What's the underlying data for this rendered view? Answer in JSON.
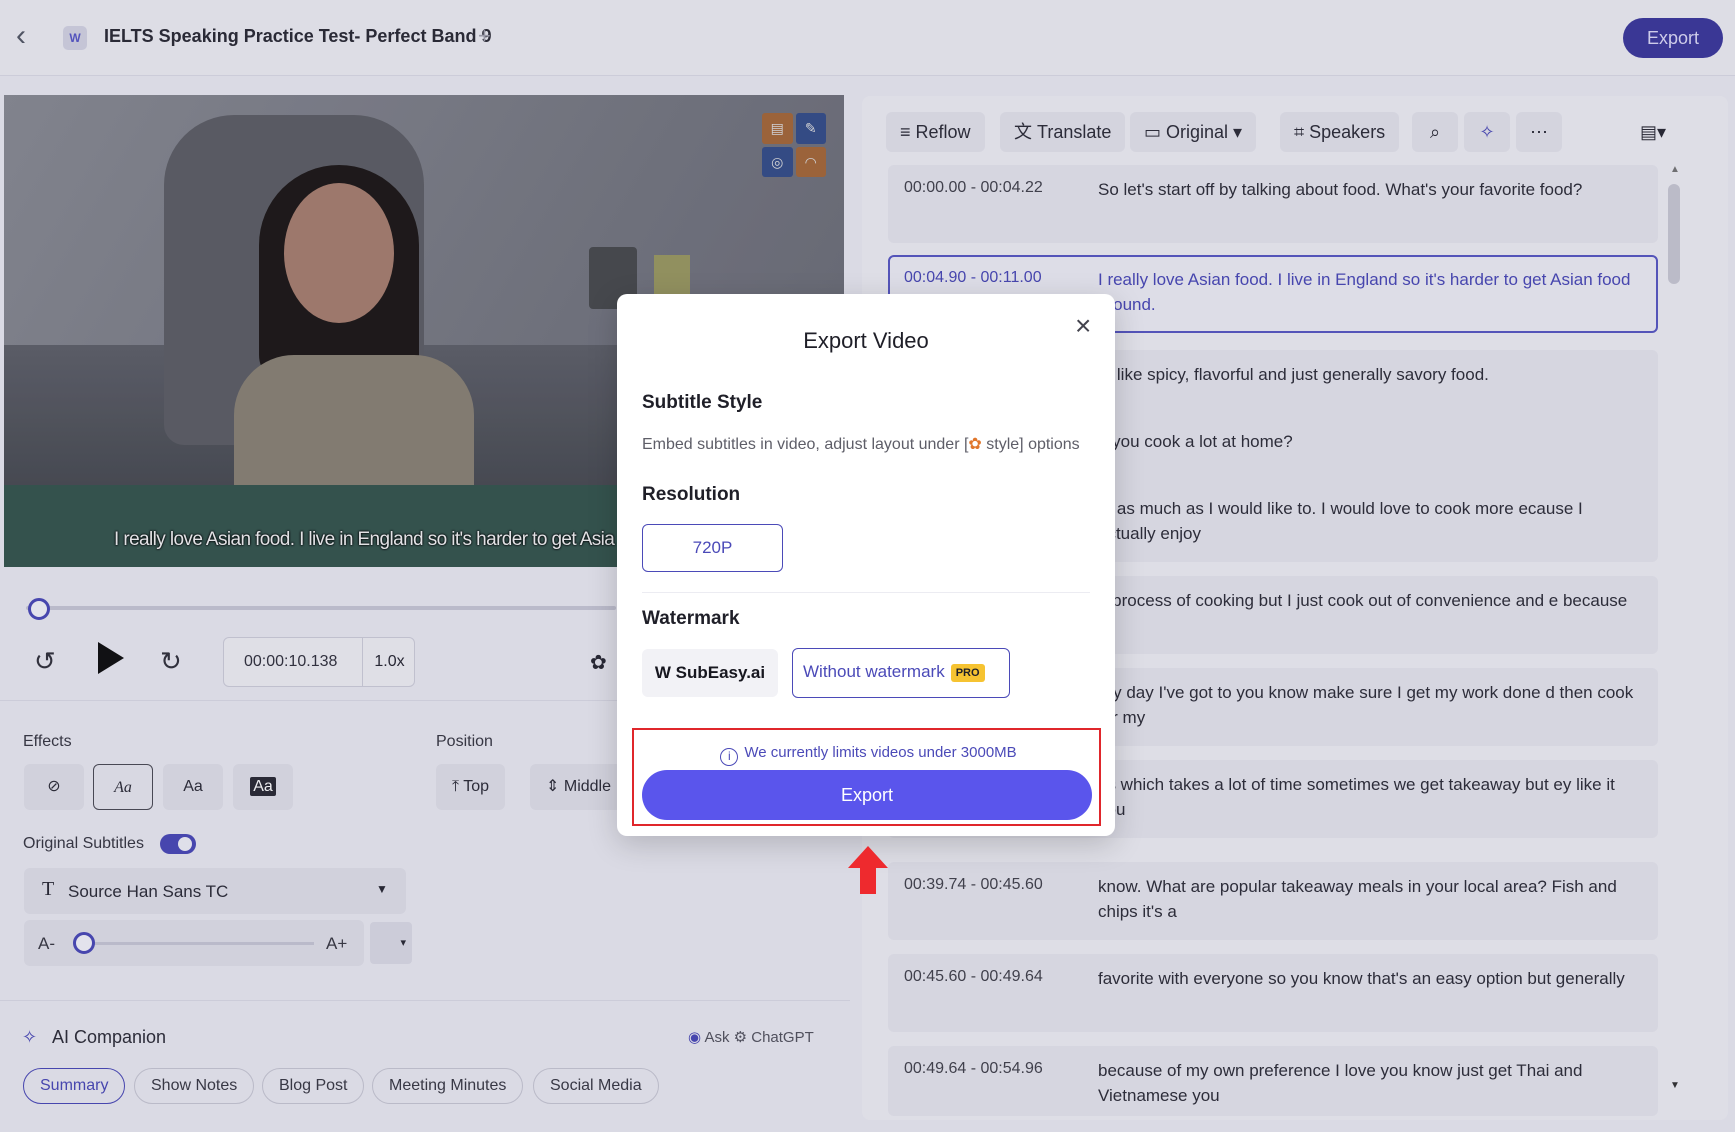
{
  "app": {
    "title": "IELTS Speaking Practice Test- Perfect Band 9",
    "export_label": "Export"
  },
  "video": {
    "subtitle_overlay": "I really love Asian food. I live in England so it's harder to get Asia"
  },
  "player": {
    "time": "00:00:10.138",
    "speed": "1.0x",
    "progress": 0.02
  },
  "style_panel": {
    "effects_label": "Effects",
    "effects": [
      "Aa",
      "Aa",
      "Aa"
    ],
    "position_label": "Position",
    "positions": [
      "Top",
      "Middle"
    ],
    "original_subtitles_label": "Original Subtitles",
    "original_subtitles_on": true,
    "font_name": "Source Han Sans TC",
    "size_minus": "A-",
    "size_plus": "A+"
  },
  "ai": {
    "title": "AI Companion",
    "ask_prefix": "Ask",
    "ask_model": "ChatGPT",
    "chips": [
      "Summary",
      "Show Notes",
      "Blog Post",
      "Meeting Minutes",
      "Social Media"
    ]
  },
  "toolbar": {
    "reflow": "Reflow",
    "translate": "Translate",
    "original": "Original",
    "speakers": "Speakers"
  },
  "transcript": [
    {
      "time": "00:00.00 - 00:04.22",
      "text": "So let's start off by talking about food. What's your favorite food?"
    },
    {
      "time": "00:04.90 - 00:11.00",
      "text": "I really love Asian food. I live in England so it's harder to get Asian food around."
    },
    {
      "time": "",
      "text": "t I like spicy, flavorful and just generally savory food."
    },
    {
      "time": "",
      "text": "o you cook a lot at home?"
    },
    {
      "time": "",
      "text": "ot as much as I would like to. I would love to cook more ecause I actually enjoy"
    },
    {
      "time": "",
      "text": "e process of cooking but I just cook out of convenience and e because"
    },
    {
      "time": "",
      "text": "ery day I've got to you know make sure I get my work done d then cook for my"
    },
    {
      "time": "",
      "text": "ds which takes a lot of time sometimes we get takeaway but ey like it you"
    },
    {
      "time": "00:39.74 - 00:45.60",
      "text": "know. What are popular takeaway meals in your local area? Fish and chips it's a"
    },
    {
      "time": "00:45.60 - 00:49.64",
      "text": "favorite with everyone so you know that's an easy option but generally"
    },
    {
      "time": "00:49.64 - 00:54.96",
      "text": "because of my own preference I love you know just get Thai and Vietnamese you"
    }
  ],
  "modal": {
    "title": "Export Video",
    "subtitle_style_heading": "Subtitle Style",
    "subtitle_style_desc": "Embed subtitles in video, adjust layout under [",
    "subtitle_style_desc_end": " style] options",
    "resolution_heading": "Resolution",
    "resolution_value": "720P",
    "watermark_heading": "Watermark",
    "watermark_brand": "SubEasy.ai",
    "watermark_none": "Without watermark",
    "pro_badge": "PRO",
    "limit_note": "We currently limits videos under 3000MB",
    "export_button": "Export"
  },
  "colors": {
    "accent": "#5a55ec",
    "highlight_red": "#e0262b",
    "pro_badge": "#f6c331"
  }
}
